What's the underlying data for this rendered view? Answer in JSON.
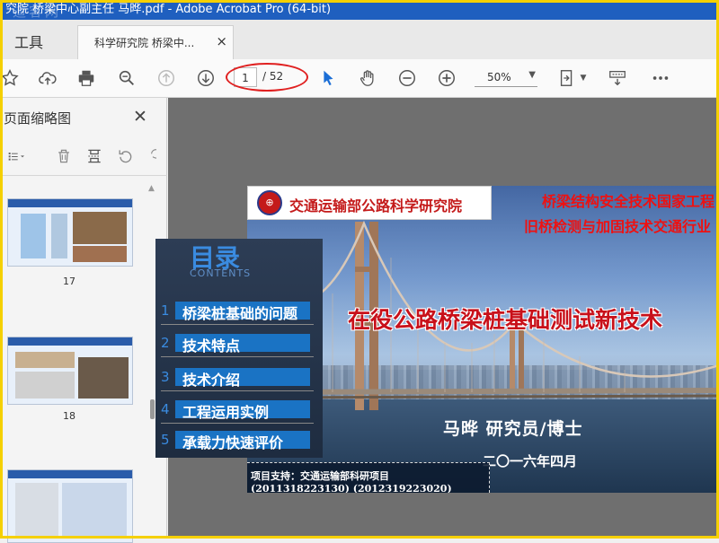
{
  "window": {
    "title": "究院 桥梁中心副主任 马晔.pdf - Adobe Acrobat Pro (64-bit)",
    "watermark": "道客网"
  },
  "tabs": {
    "tools_label": "工具",
    "doc_label": "科学研究院 桥梁中...",
    "close_glyph": "×"
  },
  "toolbar": {
    "icons": [
      "star-icon",
      "cloud-upload-icon",
      "print-icon",
      "zoom-search-icon",
      "page-up-icon",
      "page-down-icon",
      "select-arrow-icon",
      "hand-icon",
      "zoom-out-icon",
      "zoom-in-icon",
      "fit-page-icon",
      "comment-icon",
      "more-icon"
    ],
    "page_current": "1",
    "page_total": "/ 52",
    "zoom_value": "50%"
  },
  "panel": {
    "title": "页面缩略图",
    "close_glyph": "✕",
    "thumbnails": [
      {
        "page": "17"
      },
      {
        "page": "18"
      }
    ]
  },
  "slide": {
    "org_name": "交通运输部公路科学研究院",
    "lab_line1": "桥梁结构安全技术国家工程",
    "lab_line2": "旧桥检测与加固技术交通行业",
    "title": "在役公路桥梁桩基础测试新技术",
    "author": "马晔  研究员/博士",
    "date": "二〇一六年四月",
    "support_line1": "项目支持：交通运输部科研项目",
    "support_line2": "(2011318223130) (2012319223020)"
  },
  "contents": {
    "heading": "目录",
    "subheading": "CONTENTS",
    "items": [
      {
        "num": "1",
        "label": "桥梁桩基础的问题"
      },
      {
        "num": "2",
        "label": "技术特点"
      },
      {
        "num": "3",
        "label": "技术介绍"
      },
      {
        "num": "4",
        "label": "工程运用实例"
      },
      {
        "num": "5",
        "label": "承载力快速评价"
      }
    ]
  }
}
